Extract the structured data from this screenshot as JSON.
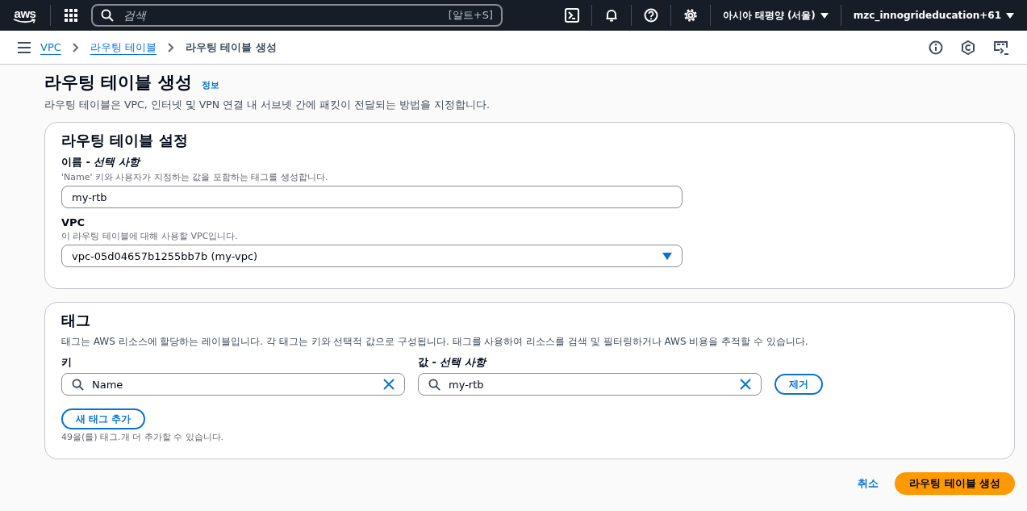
{
  "top_nav": {
    "logo": "aws",
    "search": {
      "placeholder": "검색",
      "shortcut": "[알트+S]"
    },
    "region": "아시아 태평양 (서울)",
    "account": "mzc_innogrideducation+61"
  },
  "breadcrumbs": [
    {
      "label": "VPC",
      "link": true
    },
    {
      "label": "라우팅 테이블",
      "link": true
    },
    {
      "label": "라우팅 테이블 생성",
      "link": false
    }
  ],
  "page": {
    "title": "라우팅 테이블 생성",
    "info": "정보",
    "description": "라우팅 테이블은 VPC, 인터넷 및 VPN 연결 내 서브넷 간에 패킷이 전달되는 방법을 지정합니다."
  },
  "settings": {
    "title": "라우팅 테이블 설정",
    "fields": [
      {
        "kind": "text",
        "label": "이름 - *선택 사항*",
        "description": "'Name' 키와 사용자가 지정하는 값을 포함하는 태그를 생성합니다.",
        "value": "my-rtb"
      },
      {
        "kind": "select",
        "label": "VPC",
        "description": "이 라우팅 테이블에 대해 사용할 VPC입니다.",
        "value": "vpc-05d04657b1255bb7b (my-vpc)"
      }
    ]
  },
  "tags": {
    "title": "태그",
    "description": "태그는 AWS 리소스에 할당하는 레이블입니다. 각 태그는 키와 선택적 값으로 구성됩니다. 태그를 사용하여 리소스를 검색 및 필터링하거나 AWS 비용을 추적할 수 있습니다.",
    "key_label": "키",
    "value_label": "값 - *선택 사항*",
    "rows": [
      {
        "key": "Name",
        "value": "my-rtb",
        "remove": "제거"
      }
    ],
    "add_button": "새 태그 추가",
    "limit_note": "49을(를) 태그.개 더 추가할 수 있습니다."
  },
  "actions": {
    "cancel": "취소",
    "submit": "라우팅 테이블 생성"
  }
}
